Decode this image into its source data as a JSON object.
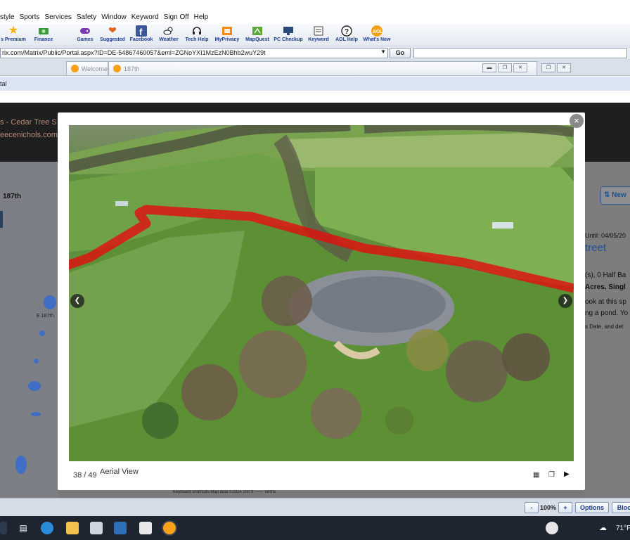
{
  "menu": [
    "style",
    "Sports",
    "Services",
    "Safety",
    "Window",
    "Keyword",
    "Sign Off",
    "Help"
  ],
  "toolbar": {
    "items": [
      {
        "label": "s Premium",
        "icon": "star-icon"
      },
      {
        "label": "Finance",
        "icon": "money-icon"
      },
      {
        "label": "Games",
        "icon": "gamepad-icon"
      },
      {
        "label": "Suggested",
        "icon": "heart-icon"
      },
      {
        "label": "Facebook",
        "icon": "facebook-icon"
      },
      {
        "label": "Weather",
        "icon": "weather-icon"
      },
      {
        "label": "Tech Help",
        "icon": "headset-icon"
      },
      {
        "label": "MyPrivacy",
        "icon": "privacy-icon"
      },
      {
        "label": "MapQuest",
        "icon": "map-icon"
      },
      {
        "label": "PC Checkup",
        "icon": "monitor-icon"
      },
      {
        "label": "Keyword",
        "icon": "keyword-icon"
      },
      {
        "label": "AOL Help",
        "icon": "help-icon"
      },
      {
        "label": "What's New",
        "icon": "aol-icon"
      }
    ]
  },
  "address": {
    "url": "rix.com/Matrix/Public/Portal.aspx?ID=DE-54867460057&eml=ZGNoYXI1MzEzN0Bhb2wuY29t",
    "go_label": "Go"
  },
  "tabs": [
    {
      "label": "Welcome"
    },
    {
      "label": "187th"
    }
  ],
  "portal_label": "tal",
  "page": {
    "title_fragment": "s - Cedar Tree S",
    "url_fragment": "eecenichols.com",
    "left_label": "187th",
    "street_label": "E 187th",
    "new_button": "⇅ New",
    "right_texts": [
      "Until: 04/05/20",
      "treet",
      "(s), 0 Half Ba",
      "Acres, Singl",
      "ook at this sp",
      "ng a pond. Yo",
      "s Date, and det"
    ],
    "map_footer": "Keyboard shortcuts    Map data ©2024    200 ft ——    Terms"
  },
  "viewer": {
    "counter": "38 / 49",
    "caption": "Aerial View",
    "close": "×",
    "prev": "❮",
    "next": "❯"
  },
  "statusbar": {
    "zoom": "100%",
    "plus": "+",
    "options": "Options",
    "block": "Block"
  },
  "taskbar": {
    "temperature": "71°F"
  },
  "colors": {
    "accent": "#1b3d8f",
    "boundary_line": "#e01010",
    "aol_orange": "#f7a11a"
  }
}
